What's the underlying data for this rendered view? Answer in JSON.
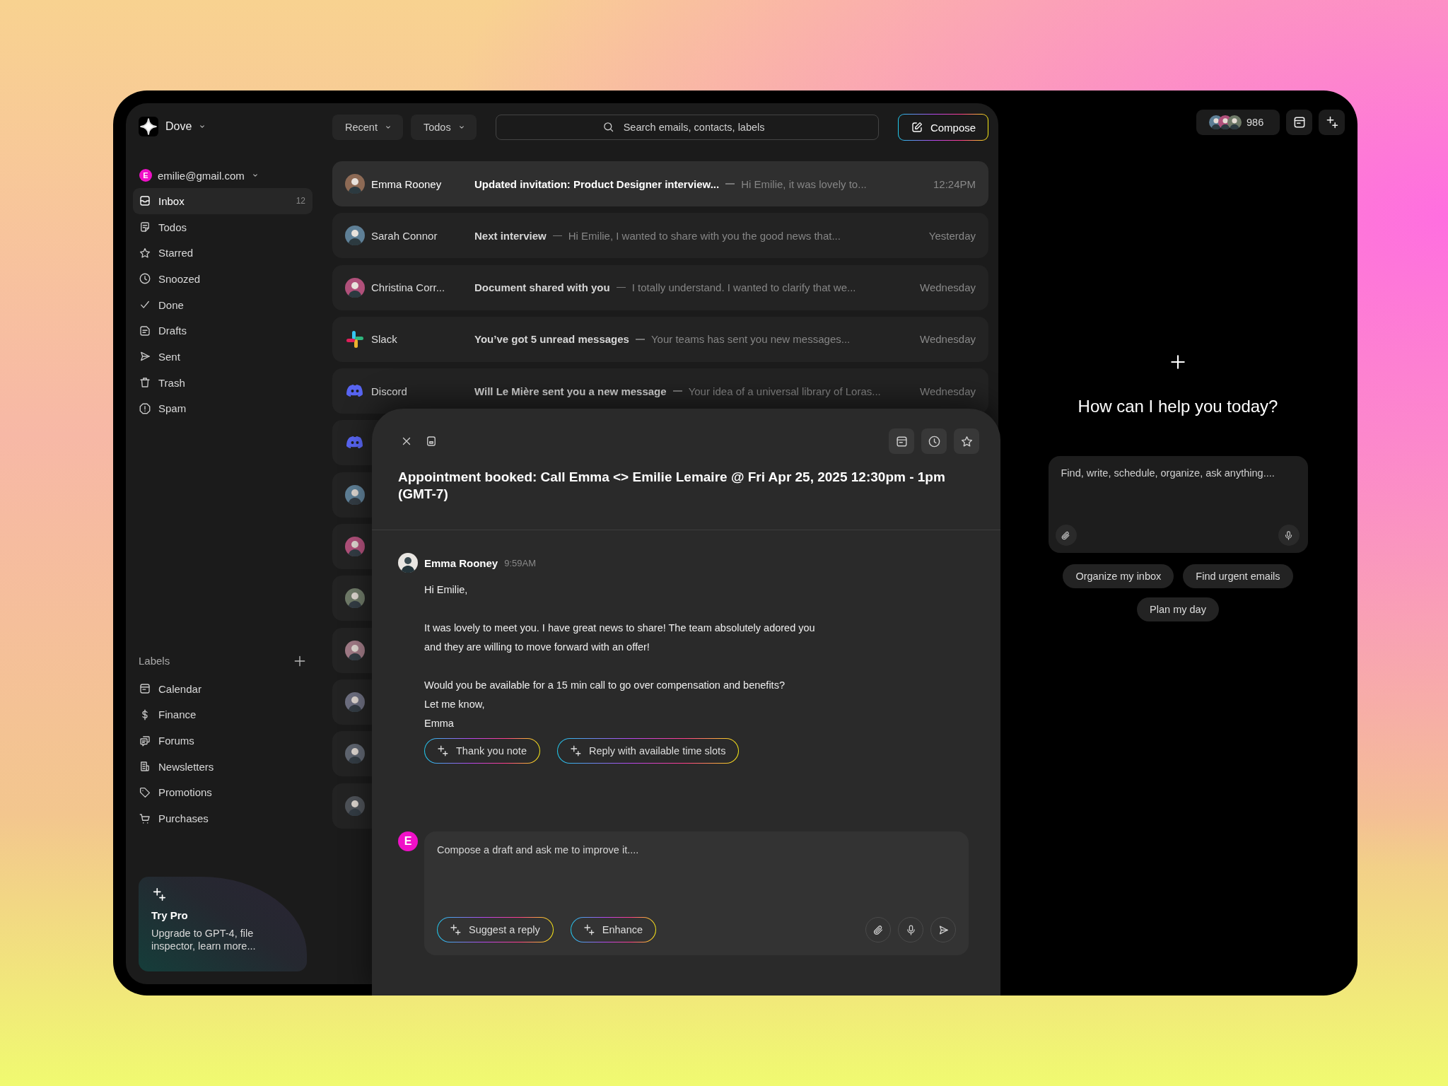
{
  "app": {
    "name": "Dove"
  },
  "account": {
    "initial": "E",
    "email": "emilie@gmail.com"
  },
  "folders": [
    {
      "label": "Inbox",
      "count": "12",
      "selected": true
    },
    {
      "label": "Todos",
      "selected": false
    },
    {
      "label": "Starred",
      "selected": false
    },
    {
      "label": "Snoozed",
      "selected": false
    },
    {
      "label": "Done",
      "selected": false
    },
    {
      "label": "Drafts",
      "selected": false
    },
    {
      "label": "Sent",
      "selected": false
    },
    {
      "label": "Trash",
      "selected": false
    },
    {
      "label": "Spam",
      "selected": false
    }
  ],
  "labels": {
    "title": "Labels",
    "items": [
      "Calendar",
      "Finance",
      "Forums",
      "Newsletters",
      "Promotions",
      "Purchases"
    ]
  },
  "promo": {
    "title": "Try Pro",
    "text": "Upgrade to GPT-4, file inspector, learn more..."
  },
  "toolbar": {
    "filters": [
      "Recent",
      "Todos"
    ],
    "search_placeholder": "Search emails, contacts, labels",
    "compose": "Compose"
  },
  "emails": [
    {
      "kind": "photo",
      "sender": "Emma Rooney",
      "subject": "Updated invitation: Product Designer interview...",
      "preview": "Hi Emilie, it was lovely to...",
      "time": "12:24PM",
      "selected": true
    },
    {
      "kind": "photo",
      "sender": "Sarah Connor",
      "subject": "Next interview",
      "preview": "Hi Emilie, I wanted to share with you the good news that...",
      "time": "Yesterday",
      "selected": false
    },
    {
      "kind": "photo",
      "sender": "Christina Corr...",
      "subject": "Document shared with you",
      "preview": "I totally understand. I wanted to clarify that we...",
      "time": "Wednesday",
      "selected": false
    },
    {
      "kind": "slack",
      "sender": "Slack",
      "subject": "You’ve got 5 unread messages",
      "preview": "Your teams has sent you new messages...",
      "time": "Wednesday",
      "selected": false
    },
    {
      "kind": "discord",
      "sender": "Discord",
      "subject": "Will Le Mière sent you a new message",
      "preview": "Your idea of a universal library of Loras...",
      "time": "Wednesday",
      "selected": false
    }
  ],
  "hidden_rows": [
    {
      "kind": "discord"
    },
    {
      "kind": "photo"
    },
    {
      "kind": "photo"
    },
    {
      "kind": "photo"
    },
    {
      "kind": "photo"
    },
    {
      "kind": "photo"
    },
    {
      "kind": "photo"
    },
    {
      "kind": "photo"
    }
  ],
  "header": {
    "count": "986"
  },
  "message": {
    "subject": "Appointment booked: Call Emma <> Emilie Lemaire @ Fri Apr 25, 2025 12:30pm - 1pm (GMT-7)",
    "sender": "Emma Rooney",
    "time": "9:59AM",
    "paragraphs": [
      [
        "Hi Emilie,"
      ],
      [
        "It was lovely to meet you. I have great news to share! The team absolutely adored you",
        "and they are willing to move forward with an offer!"
      ],
      [
        "Would you be available for a 15 min call to go over compensation and benefits?",
        "Let me know,",
        "Emma"
      ]
    ],
    "suggestions": [
      "Thank you note",
      "Reply with available time slots"
    ],
    "reply": {
      "initial": "E",
      "placeholder": "Compose a draft and ask me to improve it....",
      "actions": [
        "Suggest a reply",
        "Enhance"
      ]
    }
  },
  "assistant": {
    "heading": "How can I help you today?",
    "placeholder": "Find, write, schedule, organize, ask anything....",
    "chips": [
      "Organize my inbox",
      "Find urgent emails",
      "Plan my day"
    ]
  }
}
